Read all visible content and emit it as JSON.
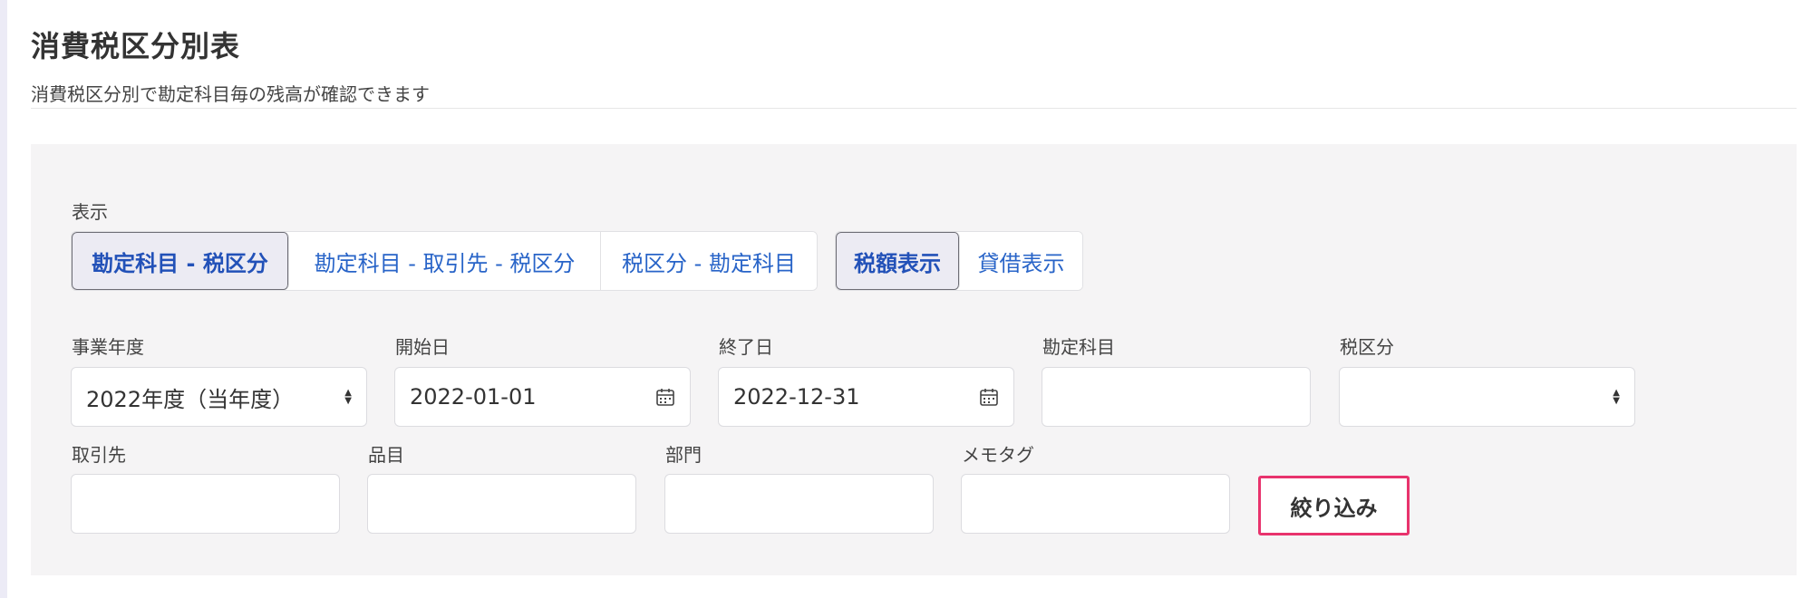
{
  "header": {
    "title": "消費税区分別表",
    "subtitle": "消費税区分別で勘定科目毎の残高が確認できます"
  },
  "display": {
    "label": "表示",
    "group_by": {
      "options": [
        "勘定科目 - 税区分",
        "勘定科目 - 取引先 - 税区分",
        "税区分 - 勘定科目"
      ],
      "selected": "勘定科目 - 税区分"
    },
    "mode": {
      "options": [
        "税額表示",
        "貸借表示"
      ],
      "selected": "税額表示"
    }
  },
  "filters": {
    "fiscal_year": {
      "label": "事業年度",
      "value": "2022年度（当年度）"
    },
    "start_date": {
      "label": "開始日",
      "value": "2022-01-01"
    },
    "end_date": {
      "label": "終了日",
      "value": "2022-12-31"
    },
    "account": {
      "label": "勘定科目",
      "value": ""
    },
    "tax_category": {
      "label": "税区分",
      "value": ""
    },
    "partner": {
      "label": "取引先",
      "value": ""
    },
    "item": {
      "label": "品目",
      "value": ""
    },
    "department": {
      "label": "部門",
      "value": ""
    },
    "memo_tag": {
      "label": "メモタグ",
      "value": ""
    },
    "submit_label": "絞り込み"
  },
  "icons": {
    "calendar": "calendar-icon",
    "select_arrows": "select-arrows-icon"
  },
  "colors": {
    "accent": "#2864c8",
    "highlight_border": "#e8336d",
    "panel_bg": "#f5f4f5"
  }
}
